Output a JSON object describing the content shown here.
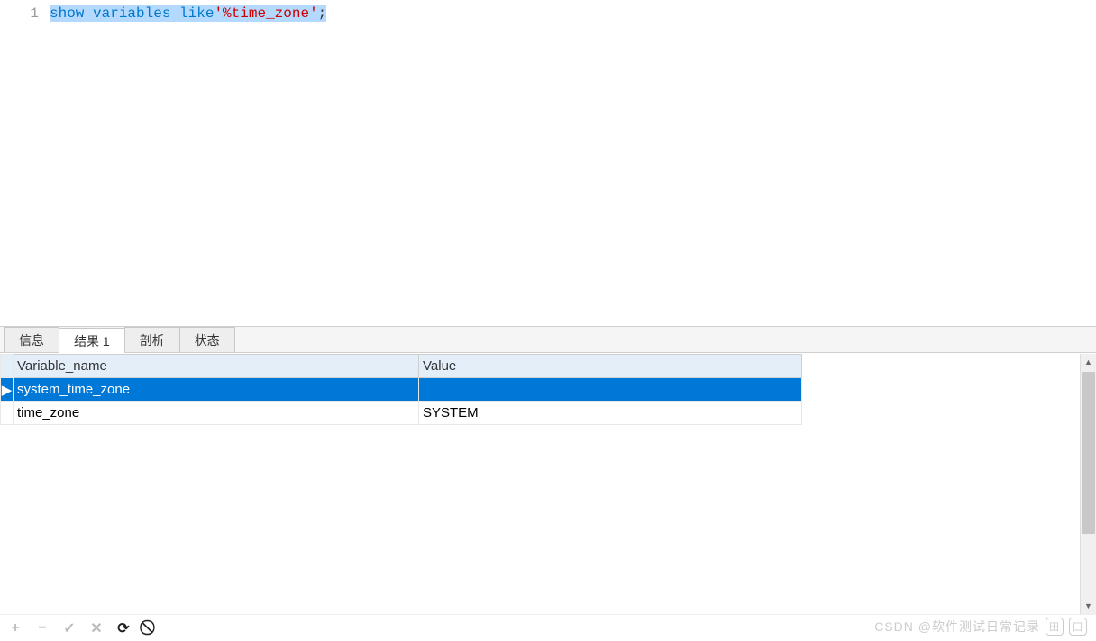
{
  "editor": {
    "line_number": "1",
    "tokens": {
      "t1": "show",
      "sp1": " ",
      "t2": "variables",
      "sp2": " ",
      "t3": "like",
      "t4": "'%time_zone'",
      "t5": ";"
    }
  },
  "tabs": {
    "info": "信息",
    "result": "结果 1",
    "profile": "剖析",
    "status": "状态"
  },
  "table": {
    "headers": {
      "col1": "Variable_name",
      "col2": "Value"
    },
    "rows": [
      {
        "indicator": "▶",
        "variable_name": "system_time_zone",
        "value": ""
      },
      {
        "indicator": "",
        "variable_name": "time_zone",
        "value": "SYSTEM"
      }
    ]
  },
  "toolbar": {
    "add": "+",
    "remove": "−",
    "apply": "✓",
    "cancel": "✕",
    "refresh": "⟳",
    "stop": "⃠"
  },
  "watermark": {
    "text": "CSDN @软件测试日常记录"
  }
}
